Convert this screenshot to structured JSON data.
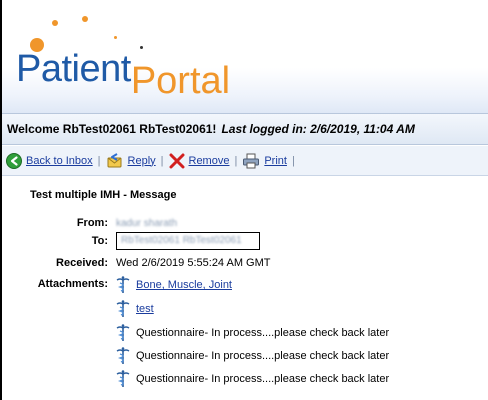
{
  "logo": {
    "part1": "Patient",
    "part2": "Portal"
  },
  "welcome": {
    "greeting": "Welcome RbTest02061 RbTest02061!",
    "last_logged": "Last logged in: 2/6/2019, 11:04 AM"
  },
  "toolbar": {
    "back_label": "Back to Inbox",
    "reply_label": "Reply",
    "remove_label": "Remove",
    "print_label": "Print"
  },
  "message": {
    "subject": "Test multiple IMH - Message",
    "from_label": "From:",
    "from_value": "kadur sharath",
    "to_label": "To:",
    "to_value": "RbTest02061 RbTest02061",
    "received_label": "Received:",
    "received_value": "Wed 2/6/2019 5:55:24 AM GMT",
    "attachments_label": "Attachments:",
    "attachments": [
      "Bone, Muscle, Joint",
      "test",
      "Questionnaire- In process....please check back later",
      "Questionnaire- In process....please check back later",
      "Questionnaire- In process....please check back later"
    ]
  }
}
